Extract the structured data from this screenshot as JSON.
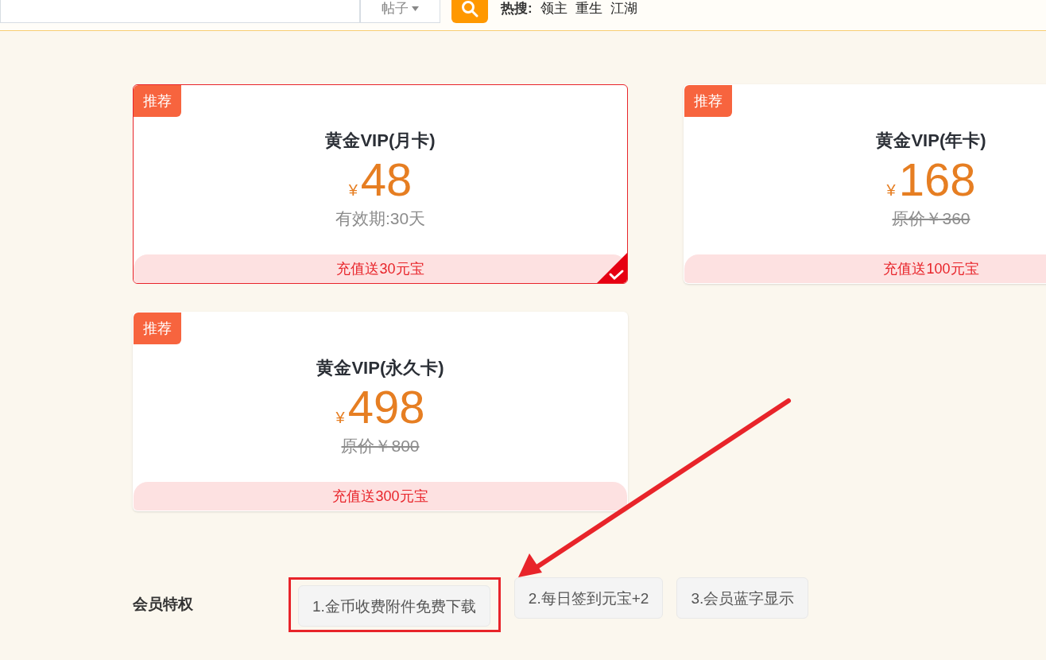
{
  "header": {
    "search_scope": "帖子",
    "hot_label": "热搜:",
    "hot_terms": [
      "领主",
      "重生",
      "江湖"
    ]
  },
  "plans": [
    {
      "badge": "推荐",
      "title": "黄金VIP(月卡)",
      "currency": "¥",
      "price": "48",
      "kind": "validity",
      "subline": "有效期:30天",
      "bonus": "充值送30元宝",
      "selected": true
    },
    {
      "badge": "推荐",
      "title": "黄金VIP(年卡)",
      "currency": "¥",
      "price": "168",
      "kind": "original_price",
      "subline": "原价￥360",
      "bonus": "充值送100元宝",
      "selected": false
    },
    {
      "badge": "推荐",
      "title": "黄金VIP(永久卡)",
      "currency": "¥",
      "price": "498",
      "kind": "original_price",
      "subline": "原价￥800",
      "bonus": "充值送300元宝",
      "selected": false
    }
  ],
  "privileges": {
    "label": "会员特权",
    "items": [
      {
        "text": "1.金币收费附件免费下载",
        "highlighted": true
      },
      {
        "text": "2.每日签到元宝+2",
        "highlighted": false
      },
      {
        "text": "3.会员蓝字显示",
        "highlighted": false
      }
    ]
  }
}
